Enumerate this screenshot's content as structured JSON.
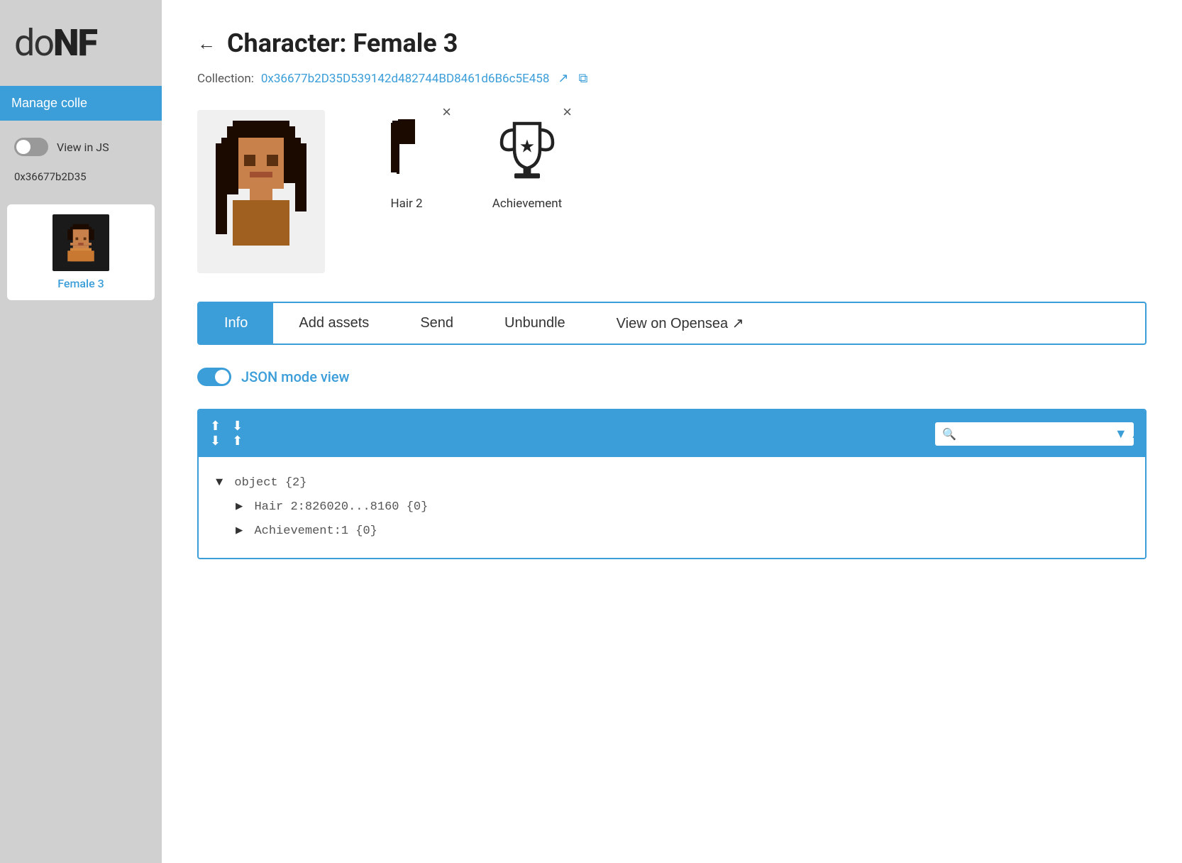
{
  "app": {
    "logo_bold": "NF",
    "logo_light": "do"
  },
  "sidebar": {
    "manage_btn": "Manage colle",
    "view_toggle_label": "View in JS",
    "toggle_on": false,
    "address_short": "0x36677b2D35",
    "card": {
      "name": "Female 3"
    }
  },
  "header": {
    "back_label": "←",
    "title": "Character: Female 3",
    "collection_label": "Collection:",
    "collection_address": "0x36677b2D35D539142d482744BD8461d6B6c5E458",
    "open_icon": "↗",
    "copy_icon": "⧉"
  },
  "assets": [
    {
      "name": "Hair 2",
      "type": "hair"
    },
    {
      "name": "Achievement",
      "type": "trophy"
    }
  ],
  "tabs": [
    {
      "label": "Info",
      "active": true
    },
    {
      "label": "Add assets",
      "active": false
    },
    {
      "label": "Send",
      "active": false
    },
    {
      "label": "Unbundle",
      "active": false
    },
    {
      "label": "View on Opensea ↗",
      "active": false
    }
  ],
  "json_mode": {
    "toggle_label": "JSON mode view",
    "enabled": true
  },
  "json_viewer": {
    "expand_all_label": "⇕",
    "collapse_all_label": "⇅",
    "search_placeholder": "",
    "content": {
      "root_label": "object {2}",
      "items": [
        {
          "key": "Hair 2:826020...8160 {0}",
          "expanded": false
        },
        {
          "key": "Achievement:1 {0}",
          "expanded": false
        }
      ]
    }
  }
}
